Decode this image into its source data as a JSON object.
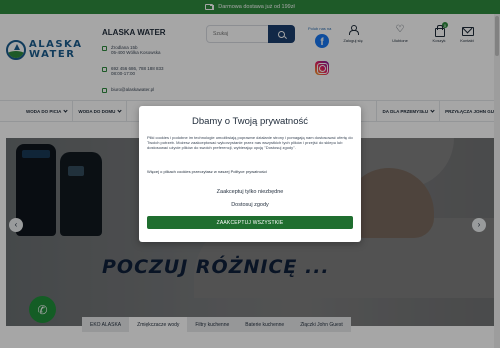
{
  "topbar": {
    "text": "Darmowa dostawa już od 199zł"
  },
  "header": {
    "logo_line1": "ALASKA",
    "logo_line2": "WATER",
    "store_name": "ALASKA WATER",
    "address_line1": "Żrodlana 15b",
    "address_line2": "05-400 Wólka Kosowska",
    "phone_line1": "692 456 686, 788 188 833",
    "phone_line2": "08:00-17:00",
    "email": "biuro@alaskawater.pl",
    "search_placeholder": "Szukaj",
    "social_label": "Polub nas na",
    "account_label": "Zaloguj się",
    "wishlist_label": "Ulubione",
    "cart_label": "Koszyk",
    "cart_count": "0",
    "contact_label": "Kontakt"
  },
  "nav": {
    "items": [
      "WODA DO PICIA",
      "WODA DO DOMU",
      "",
      "",
      "",
      "",
      "",
      "DA DLA PRZEMYSŁU",
      "PRZYŁĄCZA JOHN GU"
    ]
  },
  "hero": {
    "headline": "POCZUJ RÓŻNICĘ ..."
  },
  "tabs": [
    "EKO ALASKA",
    "Zmiękczacze wody",
    "Filtry kuchenne",
    "Baterie kuchenne",
    "Złączki John Guest"
  ],
  "active_tab": "Zmiękczacze wody",
  "modal": {
    "title": "Dbamy o Twoją prywatność",
    "body": "Pliki cookies i podobne im technologie umożliwiają poprawne działanie strony i pomagają nam dostosować ofertę do Twoich potrzeb. Możesz zaakceptować wykorzystanie przez nas wszystkich tych plików i przejść do sklepu lub dostosować użycie plików do swoich preferencji, wybierając opcję \"Dostosuj zgody\".",
    "more_info_prefix": "Więcej o plikach cookies przeczytasz w naszej",
    "more_info_link": "Polityce prywatności",
    "option_necessary": "Zaakceptuj tylko niezbędne",
    "option_customize": "Dostosuj zgody",
    "accept_all": "ZAAKCEPTUJ WSZYSTKIE"
  },
  "colors": {
    "brand_green": "#2e8b3e",
    "brand_navy": "#1b3e6e",
    "accept_green": "#1f6e2f"
  }
}
